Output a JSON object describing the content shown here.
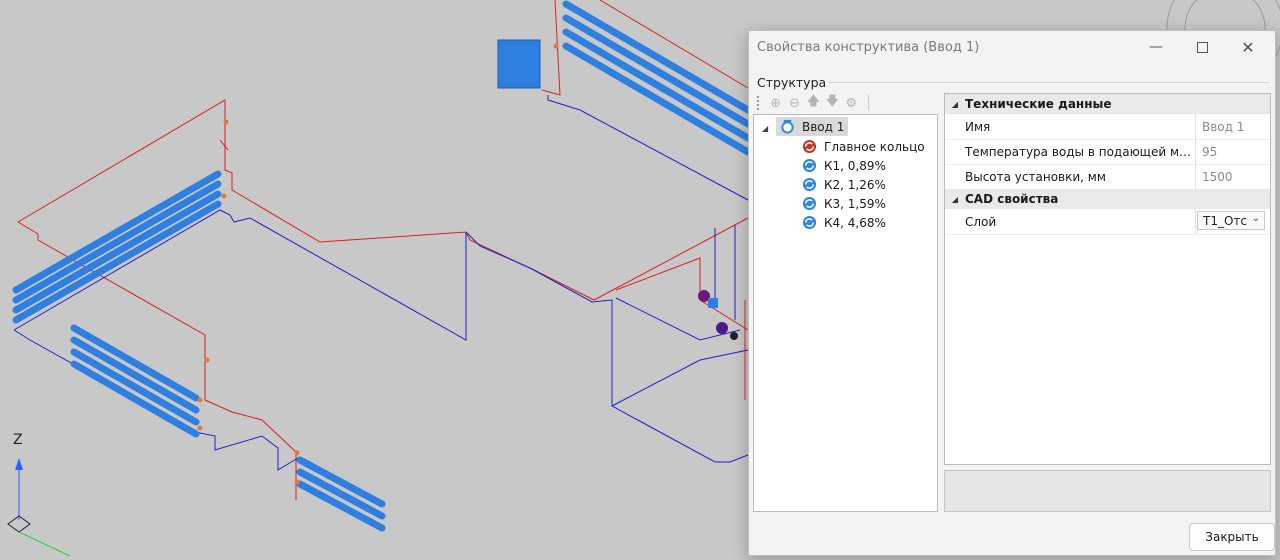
{
  "dialog": {
    "title": "Свойства конструктива (Ввод 1)",
    "close_label": "Закрыть"
  },
  "structure": {
    "group_label": "Структура",
    "toolbar_icons": [
      "add-icon",
      "remove-icon",
      "arrow-up-icon",
      "arrow-down-icon",
      "settings-icon"
    ],
    "root": {
      "label": "Ввод 1",
      "icon": "inlet-icon"
    },
    "children": [
      {
        "label": "Главное кольцо",
        "icon": "main-ring-icon",
        "color": "#c0392b"
      },
      {
        "label": "К1, 0,89%",
        "icon": "ring-icon",
        "color": "#2e86de"
      },
      {
        "label": "К2, 1,26%",
        "icon": "ring-icon",
        "color": "#2e86de"
      },
      {
        "label": "К3, 1,59%",
        "icon": "ring-icon",
        "color": "#2e86de"
      },
      {
        "label": "К4, 4,68%",
        "icon": "ring-icon",
        "color": "#2e86de"
      }
    ]
  },
  "properties": {
    "technical": {
      "title": "Технические данные",
      "rows": [
        {
          "name": "Имя",
          "value": "Ввод 1"
        },
        {
          "name": "Температура воды в подающей магистрали",
          "value": "95"
        },
        {
          "name": "Высота установки, мм",
          "value": "1500"
        }
      ]
    },
    "cad": {
      "title": "CAD свойства",
      "layer_name": "Слой",
      "layer_value": "T1_Отс"
    }
  },
  "axis": {
    "z_label": "Z"
  },
  "colors": {
    "supply": "#d62020",
    "return": "#2020c8",
    "radiator": "#2f7fe0",
    "background": "#c8c8c8"
  }
}
